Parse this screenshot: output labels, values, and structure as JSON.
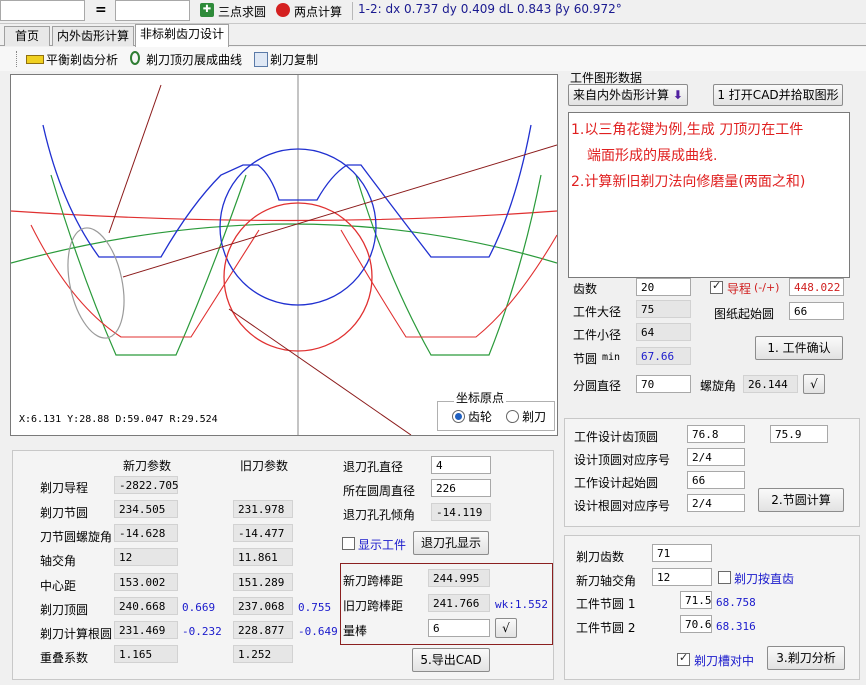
{
  "topbar": {
    "eq": "=",
    "btn_three_point": "三点求圆",
    "btn_two_point": "两点计算",
    "measure": "1-2: dx 0.737 dy 0.409 dL 0.843 βy 60.972°"
  },
  "tabs": [
    "首页",
    "内外齿形计算",
    "非标剃齿刀设计"
  ],
  "toolbar": {
    "balance": "平衡剃齿分析",
    "involute": "剃刀顶刃展成曲线",
    "copy": "剃刀复制"
  },
  "canvas": {
    "readout": "X:6.131  Y:28.88  D:59.047  R:29.524",
    "origin_group": "坐标原点",
    "radio_gear": "齿轮",
    "radio_cutter": "剃刀"
  },
  "workpiece": {
    "title": "工件图形数据",
    "btn_from_calc": "来自内外齿形计算",
    "btn_cad": "1 打开CAD并拾取图形",
    "note_line1": "1.以三角花键为例,生成 刀顶刃在工件",
    "note_line2": "端面形成的展成曲线.",
    "note_line3": "2.计算新旧剃刀法向修磨量(两面之和)",
    "teeth_label": "齿数",
    "teeth": "20",
    "lead_label": "导程",
    "lead_sign": "(-/+)",
    "lead": "448.022",
    "major_label": "工件大径",
    "major": "75",
    "start_circle_label": "图纸起始圆",
    "start_circle": "66",
    "minor_label": "工件小径",
    "minor": "64",
    "pitch_label": "节圆",
    "pitch_unit": "min",
    "pitch": "67.66",
    "btn_confirm": "1. 工件确认",
    "ref_dia_label": "分圆直径",
    "ref_dia": "70",
    "helix_label": "螺旋角",
    "helix": "26.144",
    "btn_check": "√"
  },
  "design": {
    "tip_label": "工件设计齿顶圆",
    "tip1": "76.8",
    "tip2": "75.9",
    "tip_seq_label": "设计顶圆对应序号",
    "tip_seq": "2/4",
    "start_label": "工作设计起始圆",
    "start": "66",
    "root_seq_label": "设计根圆对应序号",
    "root_seq": "2/4",
    "btn_pitch": "2.节圆计算"
  },
  "cutter": {
    "teeth_label": "剃刀齿数",
    "teeth": "71",
    "axis_label": "新刀轴交角",
    "axis": "12",
    "straight_label": "剃刀按直齿",
    "pitch1_label": "工件节圆 1",
    "pitch1": "71.5",
    "pitch1_b": "68.758",
    "pitch2_label": "工件节圆 2",
    "pitch2": "70.6",
    "pitch2_b": "68.316",
    "slot_label": "剃刀槽对中",
    "btn_analyze": "3.剃刀分析"
  },
  "params": {
    "new_header": "新刀参数",
    "old_header": "旧刀参数",
    "rows": [
      {
        "label": "剃刀导程",
        "new": "-2822.705",
        "old": ""
      },
      {
        "label": "剃刀节圆",
        "new": "234.505",
        "old": "231.978"
      },
      {
        "label": "刀节圆螺旋角",
        "new": "-14.628",
        "old": "-14.477"
      },
      {
        "label": "轴交角",
        "new": "12",
        "old": "11.861"
      },
      {
        "label": "中心距",
        "new": "153.002",
        "old": "151.289"
      },
      {
        "label": "剃刀顶圆",
        "new": "240.668",
        "old": "237.068",
        "new_b": "0.669",
        "old_b": "0.755"
      },
      {
        "label": "剃刀计算根圆",
        "new": "231.469",
        "old": "228.877",
        "new_b": "-0.232",
        "old_b": "-0.649"
      },
      {
        "label": "重叠系数",
        "new": "1.165",
        "old": "1.252"
      }
    ],
    "relief_dia_label": "退刀孔直径",
    "relief_dia": "4",
    "circle_dia_label": "所在圆周直径",
    "circle_dia": "226",
    "relief_angle_label": "退刀孔孔倾角",
    "relief_angle": "-14.119",
    "show_work_label": "显示工件",
    "btn_relief": "退刀孔显示",
    "new_span_label": "新刀跨棒距",
    "new_span": "244.995",
    "old_span_label": "旧刀跨棒距",
    "old_span": "241.766",
    "wk": "wk:1.552",
    "pin_label": "量棒",
    "pin": "6",
    "btn_pin_check": "√",
    "btn_export": "5.导出CAD"
  }
}
